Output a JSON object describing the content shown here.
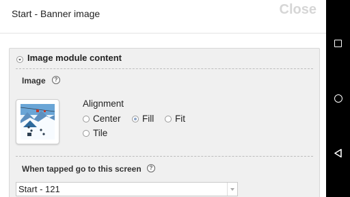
{
  "header": {
    "title": "Start - Banner image",
    "close_label": "Close"
  },
  "panel": {
    "title": "Image module content",
    "image_label": "Image",
    "help_glyph": "?",
    "alignment": {
      "label": "Alignment",
      "options": [
        {
          "label": "Center",
          "selected": false
        },
        {
          "label": "Fill",
          "selected": true
        },
        {
          "label": "Fit",
          "selected": false
        },
        {
          "label": "Tile",
          "selected": false
        }
      ]
    },
    "tap_target": {
      "label": "When tapped go to this screen",
      "value": "Start - 121"
    }
  },
  "navbar": {
    "icons": [
      "recents-square-icon",
      "home-circle-icon",
      "back-triangle-icon"
    ]
  }
}
